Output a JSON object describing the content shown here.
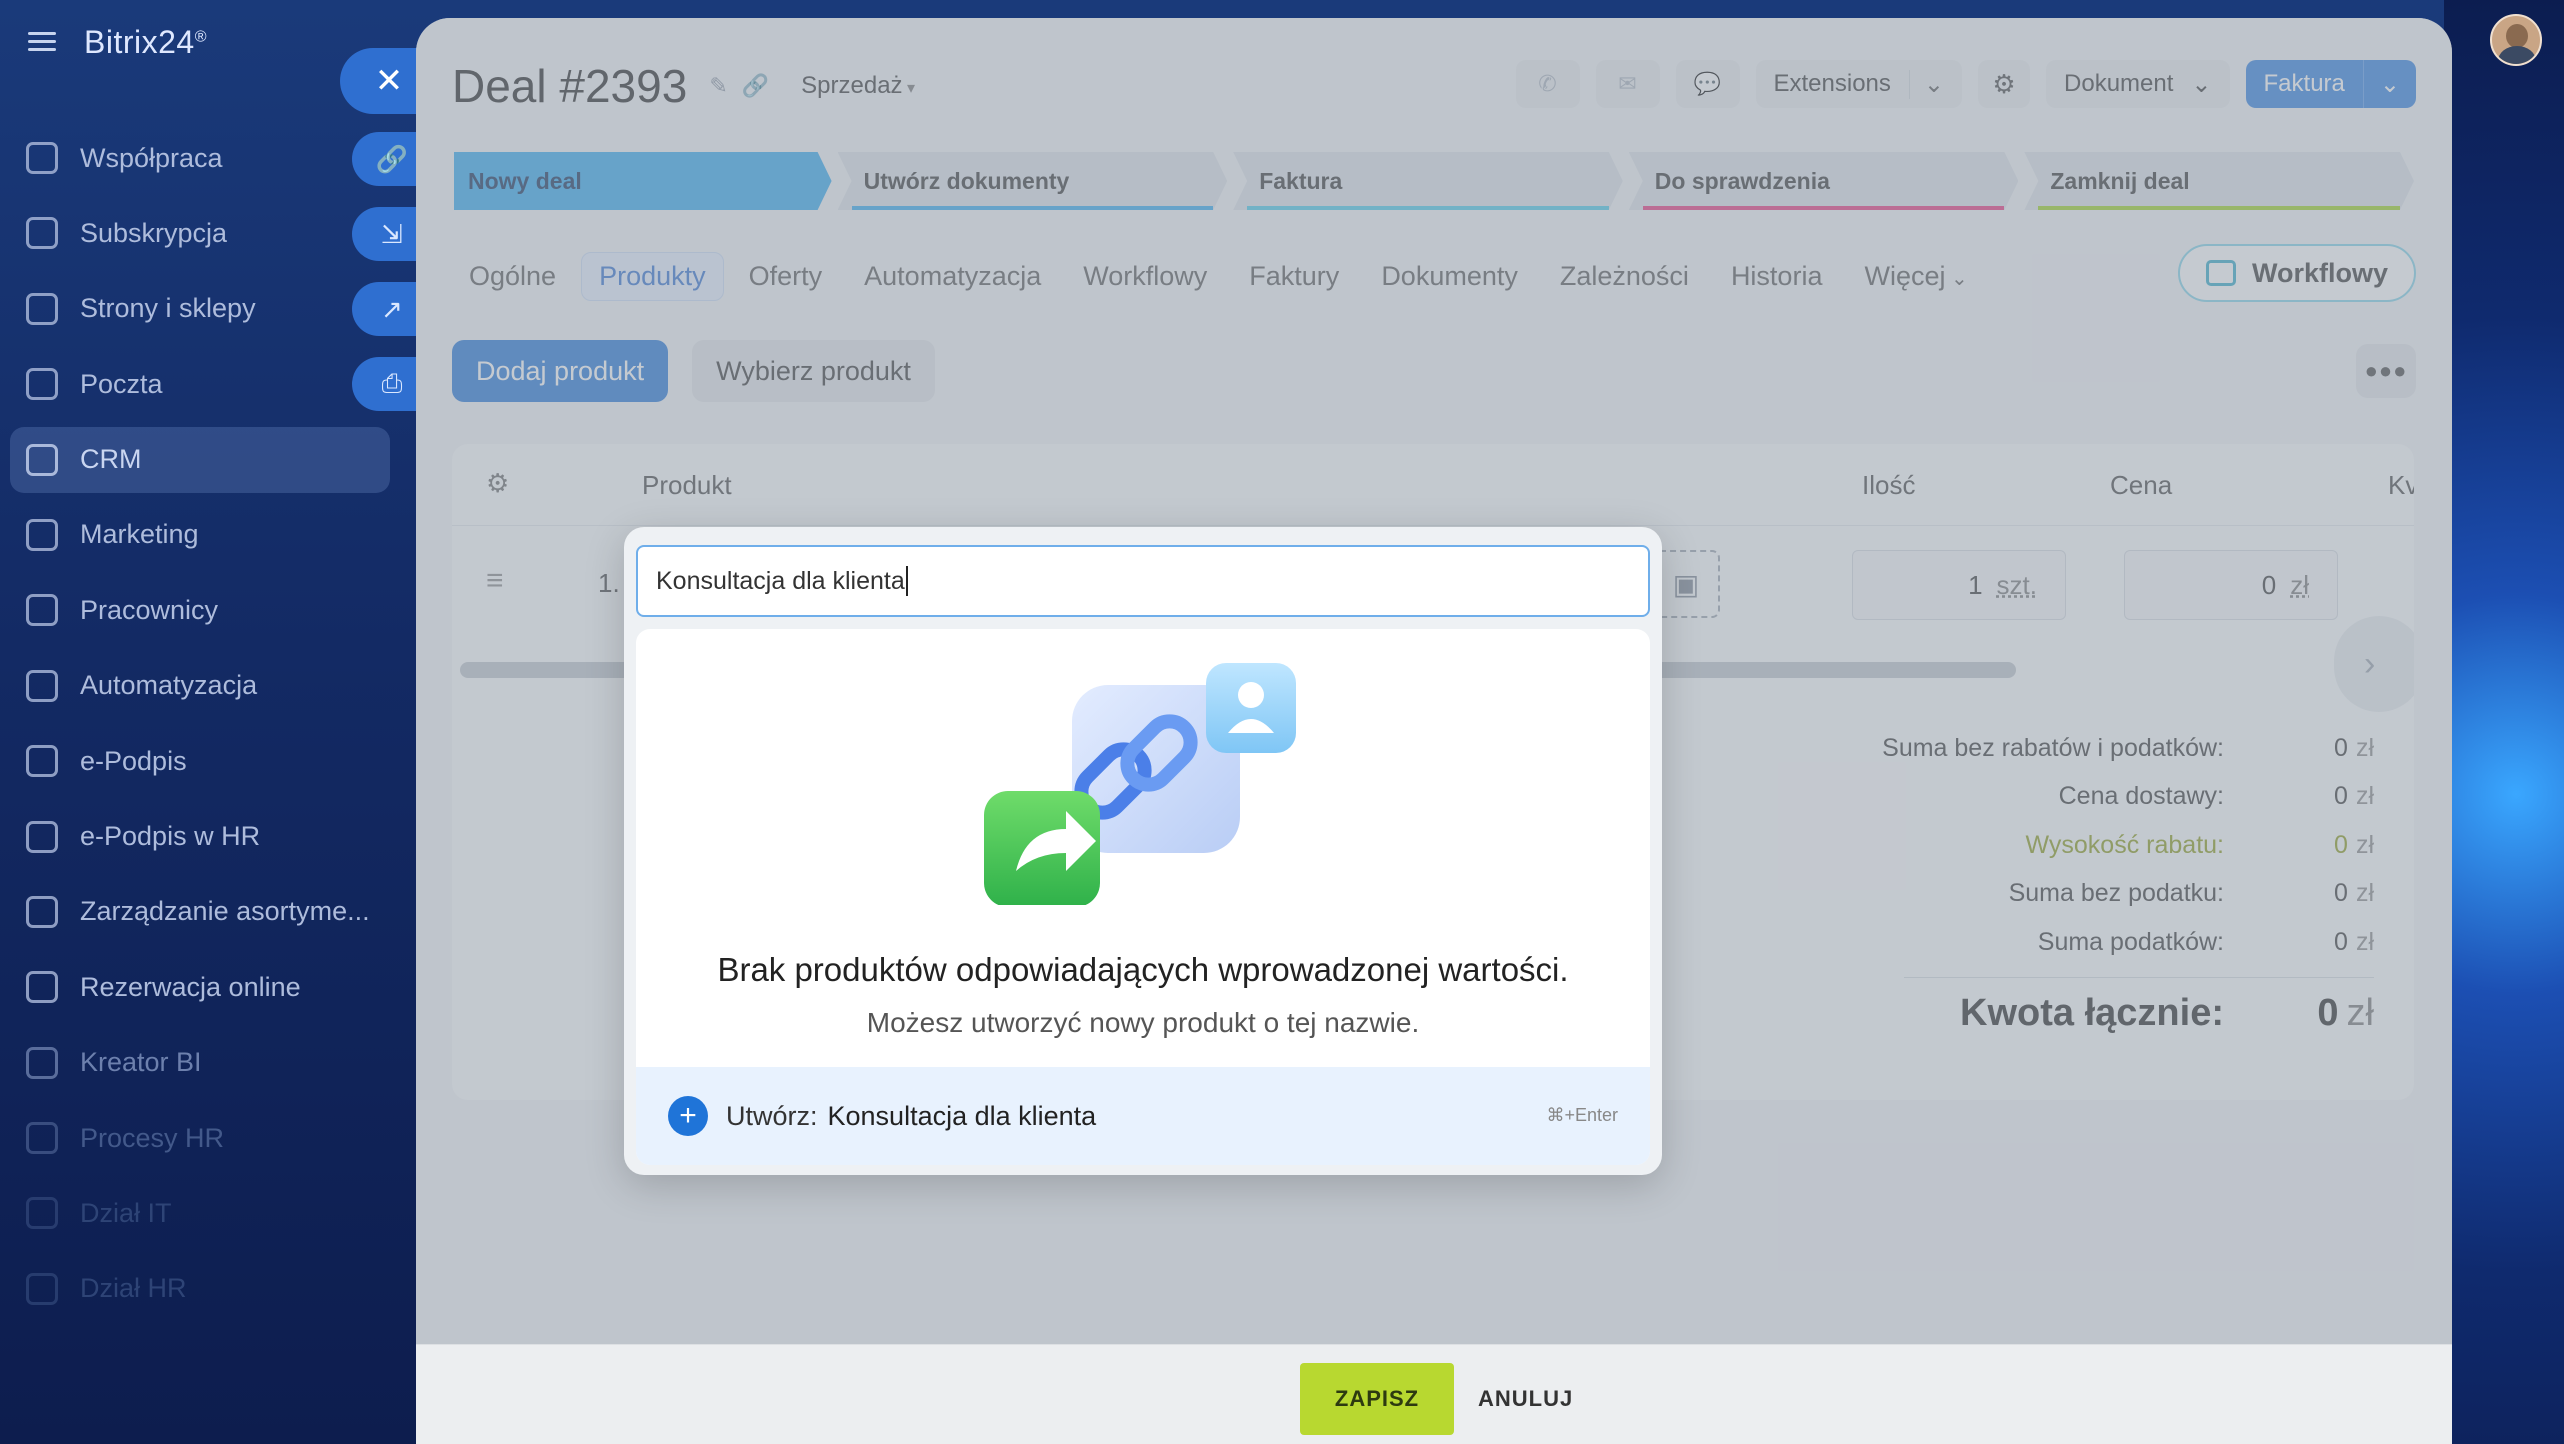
{
  "app": {
    "brand": "Bitrix24",
    "brand_mark": "®"
  },
  "sidebar": {
    "items": [
      {
        "label": "Współpraca",
        "icon": "collaboration-icon"
      },
      {
        "label": "Subskrypcja",
        "icon": "subscription-icon"
      },
      {
        "label": "Strony i sklepy",
        "icon": "cart-icon"
      },
      {
        "label": "Poczta",
        "icon": "mail-icon"
      },
      {
        "label": "CRM",
        "icon": "crm-icon",
        "active": true
      },
      {
        "label": "Marketing",
        "icon": "marketing-icon"
      },
      {
        "label": "Pracownicy",
        "icon": "employees-icon"
      },
      {
        "label": "Automatyzacja",
        "icon": "automation-icon"
      },
      {
        "label": "e-Podpis",
        "icon": "signature-icon"
      },
      {
        "label": "e-Podpis w HR",
        "icon": "hr-signature-icon"
      },
      {
        "label": "Zarządzanie asortyme...",
        "icon": "inventory-icon"
      },
      {
        "label": "Rezerwacja online",
        "icon": "booking-icon"
      },
      {
        "label": "Kreator BI",
        "icon": "bi-icon"
      },
      {
        "label": "Procesy HR",
        "icon": "hr-process-icon"
      },
      {
        "label": "Dział IT",
        "icon": "it-icon"
      },
      {
        "label": "Dział HR",
        "icon": "hr-icon"
      }
    ]
  },
  "deal": {
    "title": "Deal #2393",
    "pipeline": "Sprzedaż"
  },
  "toolbar": {
    "extensions": "Extensions",
    "dokument": "Dokument",
    "faktura": "Faktura"
  },
  "stages": [
    {
      "label": "Nowy deal",
      "color": "#2fa8f0"
    },
    {
      "label": "Utwórz dokumenty",
      "color": "#2fa8f0"
    },
    {
      "label": "Faktura",
      "color": "#47c9e8"
    },
    {
      "label": "Do sprawdzenia",
      "color": "#e8327a"
    },
    {
      "label": "Zamknij deal",
      "color": "#9bd21e"
    }
  ],
  "tabs": [
    {
      "label": "Ogólne"
    },
    {
      "label": "Produkty",
      "active": true
    },
    {
      "label": "Oferty"
    },
    {
      "label": "Automatyzacja"
    },
    {
      "label": "Workflowy"
    },
    {
      "label": "Faktury"
    },
    {
      "label": "Dokumenty"
    },
    {
      "label": "Zależności"
    },
    {
      "label": "Historia"
    },
    {
      "label": "Więcej",
      "more": true
    }
  ],
  "workflow_button": "Workflowy",
  "product_actions": {
    "add": "Dodaj produkt",
    "select": "Wybierz produkt"
  },
  "table": {
    "headers": {
      "product": "Produkt",
      "qty": "Ilość",
      "price": "Cena",
      "amount": "Kv"
    },
    "row": {
      "index": "1.",
      "qty": "1",
      "qty_unit": "szt.",
      "price": "0",
      "price_unit": "zł"
    }
  },
  "totals": {
    "rows": [
      {
        "label": "Suma bez rabatów i podatków:",
        "value": "0",
        "currency": "zł"
      },
      {
        "label": "Cena dostawy:",
        "value": "0",
        "currency": "zł"
      },
      {
        "label": "Wysokość rabatu:",
        "value": "0",
        "currency": "zł",
        "discount": true
      },
      {
        "label": "Suma bez podatku:",
        "value": "0",
        "currency": "zł"
      },
      {
        "label": "Suma podatków:",
        "value": "0",
        "currency": "zł"
      }
    ],
    "total_label": "Kwota łącznie:",
    "total_value": "0",
    "total_currency": "zł"
  },
  "popup": {
    "search_value": "Konsultacja dla klienta",
    "empty_title": "Brak produktów odpowiadających wprowadzonej wartości.",
    "empty_subtitle": "Możesz utworzyć nowy produkt o tej nazwie.",
    "create_prefix": "Utwórz:",
    "create_name": "Konsultacja dla klienta",
    "hotkey": "⌘+Enter"
  },
  "footer": {
    "save": "ZAPISZ",
    "cancel": "ANULUJ"
  }
}
